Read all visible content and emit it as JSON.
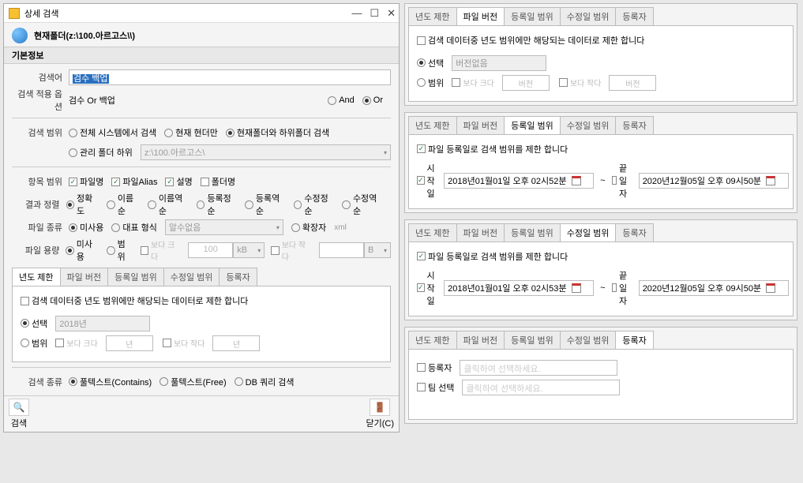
{
  "window": {
    "title": "상세 검색",
    "path": "현재폴더(z:\\100.아르고스\\\\)"
  },
  "section_basic": "기본정보",
  "labels": {
    "search_term": "검색어",
    "apply_option": "검색 적용 옵션",
    "search_scope": "검색 범위",
    "item_scope": "항목 범위",
    "result_sort": "결과 정렬",
    "file_type": "파일 종류",
    "file_size": "파일 용량",
    "search_kind": "검색 종류"
  },
  "search_term_value": "검수 백업",
  "apply_option": {
    "text": "검수 Or 백업",
    "and": "And",
    "or": "Or"
  },
  "scope": {
    "all_system": "전체 시스템에서 검색",
    "current_folder": "현재 현더만",
    "current_and_sub": "현재폴더와 하위폴더 검색",
    "managed_sub": "관리 폴더 하위",
    "path_value": "z:\\100.아르고스\\"
  },
  "item_scope": {
    "filename": "파일명",
    "alias": "파일Alias",
    "desc": "설명",
    "folder": "폴더명"
  },
  "sort": {
    "accuracy": "정확도",
    "name": "이름순",
    "name_rev": "이름역순",
    "reg": "등록정순",
    "reg_rev": "등록역순",
    "mod": "수정정순",
    "mod_rev": "수정역순"
  },
  "file_type": {
    "unused": "미사용",
    "format": "대표 형식",
    "format_ph": "알수없음",
    "ext": "확장자",
    "ext_val": "xml"
  },
  "file_size": {
    "unused": "미사용",
    "range": "범위",
    "gt": "보다 크다",
    "lt": "보다 작다",
    "val": "100",
    "unit": "kB",
    "unit2": "B"
  },
  "tabs": {
    "year": "년도 제한",
    "version": "파일 버전",
    "reg_range": "등록일 범위",
    "mod_range": "수정일 범위",
    "registrant": "등록자"
  },
  "year_panel": {
    "note": "검색 데이터중 년도 범위에만 해당되는 데이터로 제한 합니다",
    "select": "선택",
    "year_val": "2018년",
    "range": "범위",
    "gt": "보다 크다",
    "lt": "보다 작다",
    "unit": "년",
    "version_ph": "버전없음",
    "version_unit": "버전"
  },
  "reg_panel": {
    "note": "파일 등록일로 검색 범위를 제한 합니다",
    "start": "시작일",
    "end": "끝일자",
    "start_val": "2018년01월01일 오후 02시52분",
    "end_val": "2020년12월05일 오후 09시50분"
  },
  "mod_panel": {
    "start_val": "2018년01월01일 오후 02시53분",
    "end_val": "2020년12월05일 오후 09시50분"
  },
  "registrant_panel": {
    "registrant": "등록자",
    "team": "팀 선택",
    "ph": "클릭하여 선택하세요."
  },
  "search_kind": {
    "contains": "풀텍스트(Contains)",
    "free": "풀텍스트(Free)",
    "db": "DB 쿼리 검색"
  },
  "footer": {
    "search": "검색",
    "close": "닫기(C)"
  }
}
